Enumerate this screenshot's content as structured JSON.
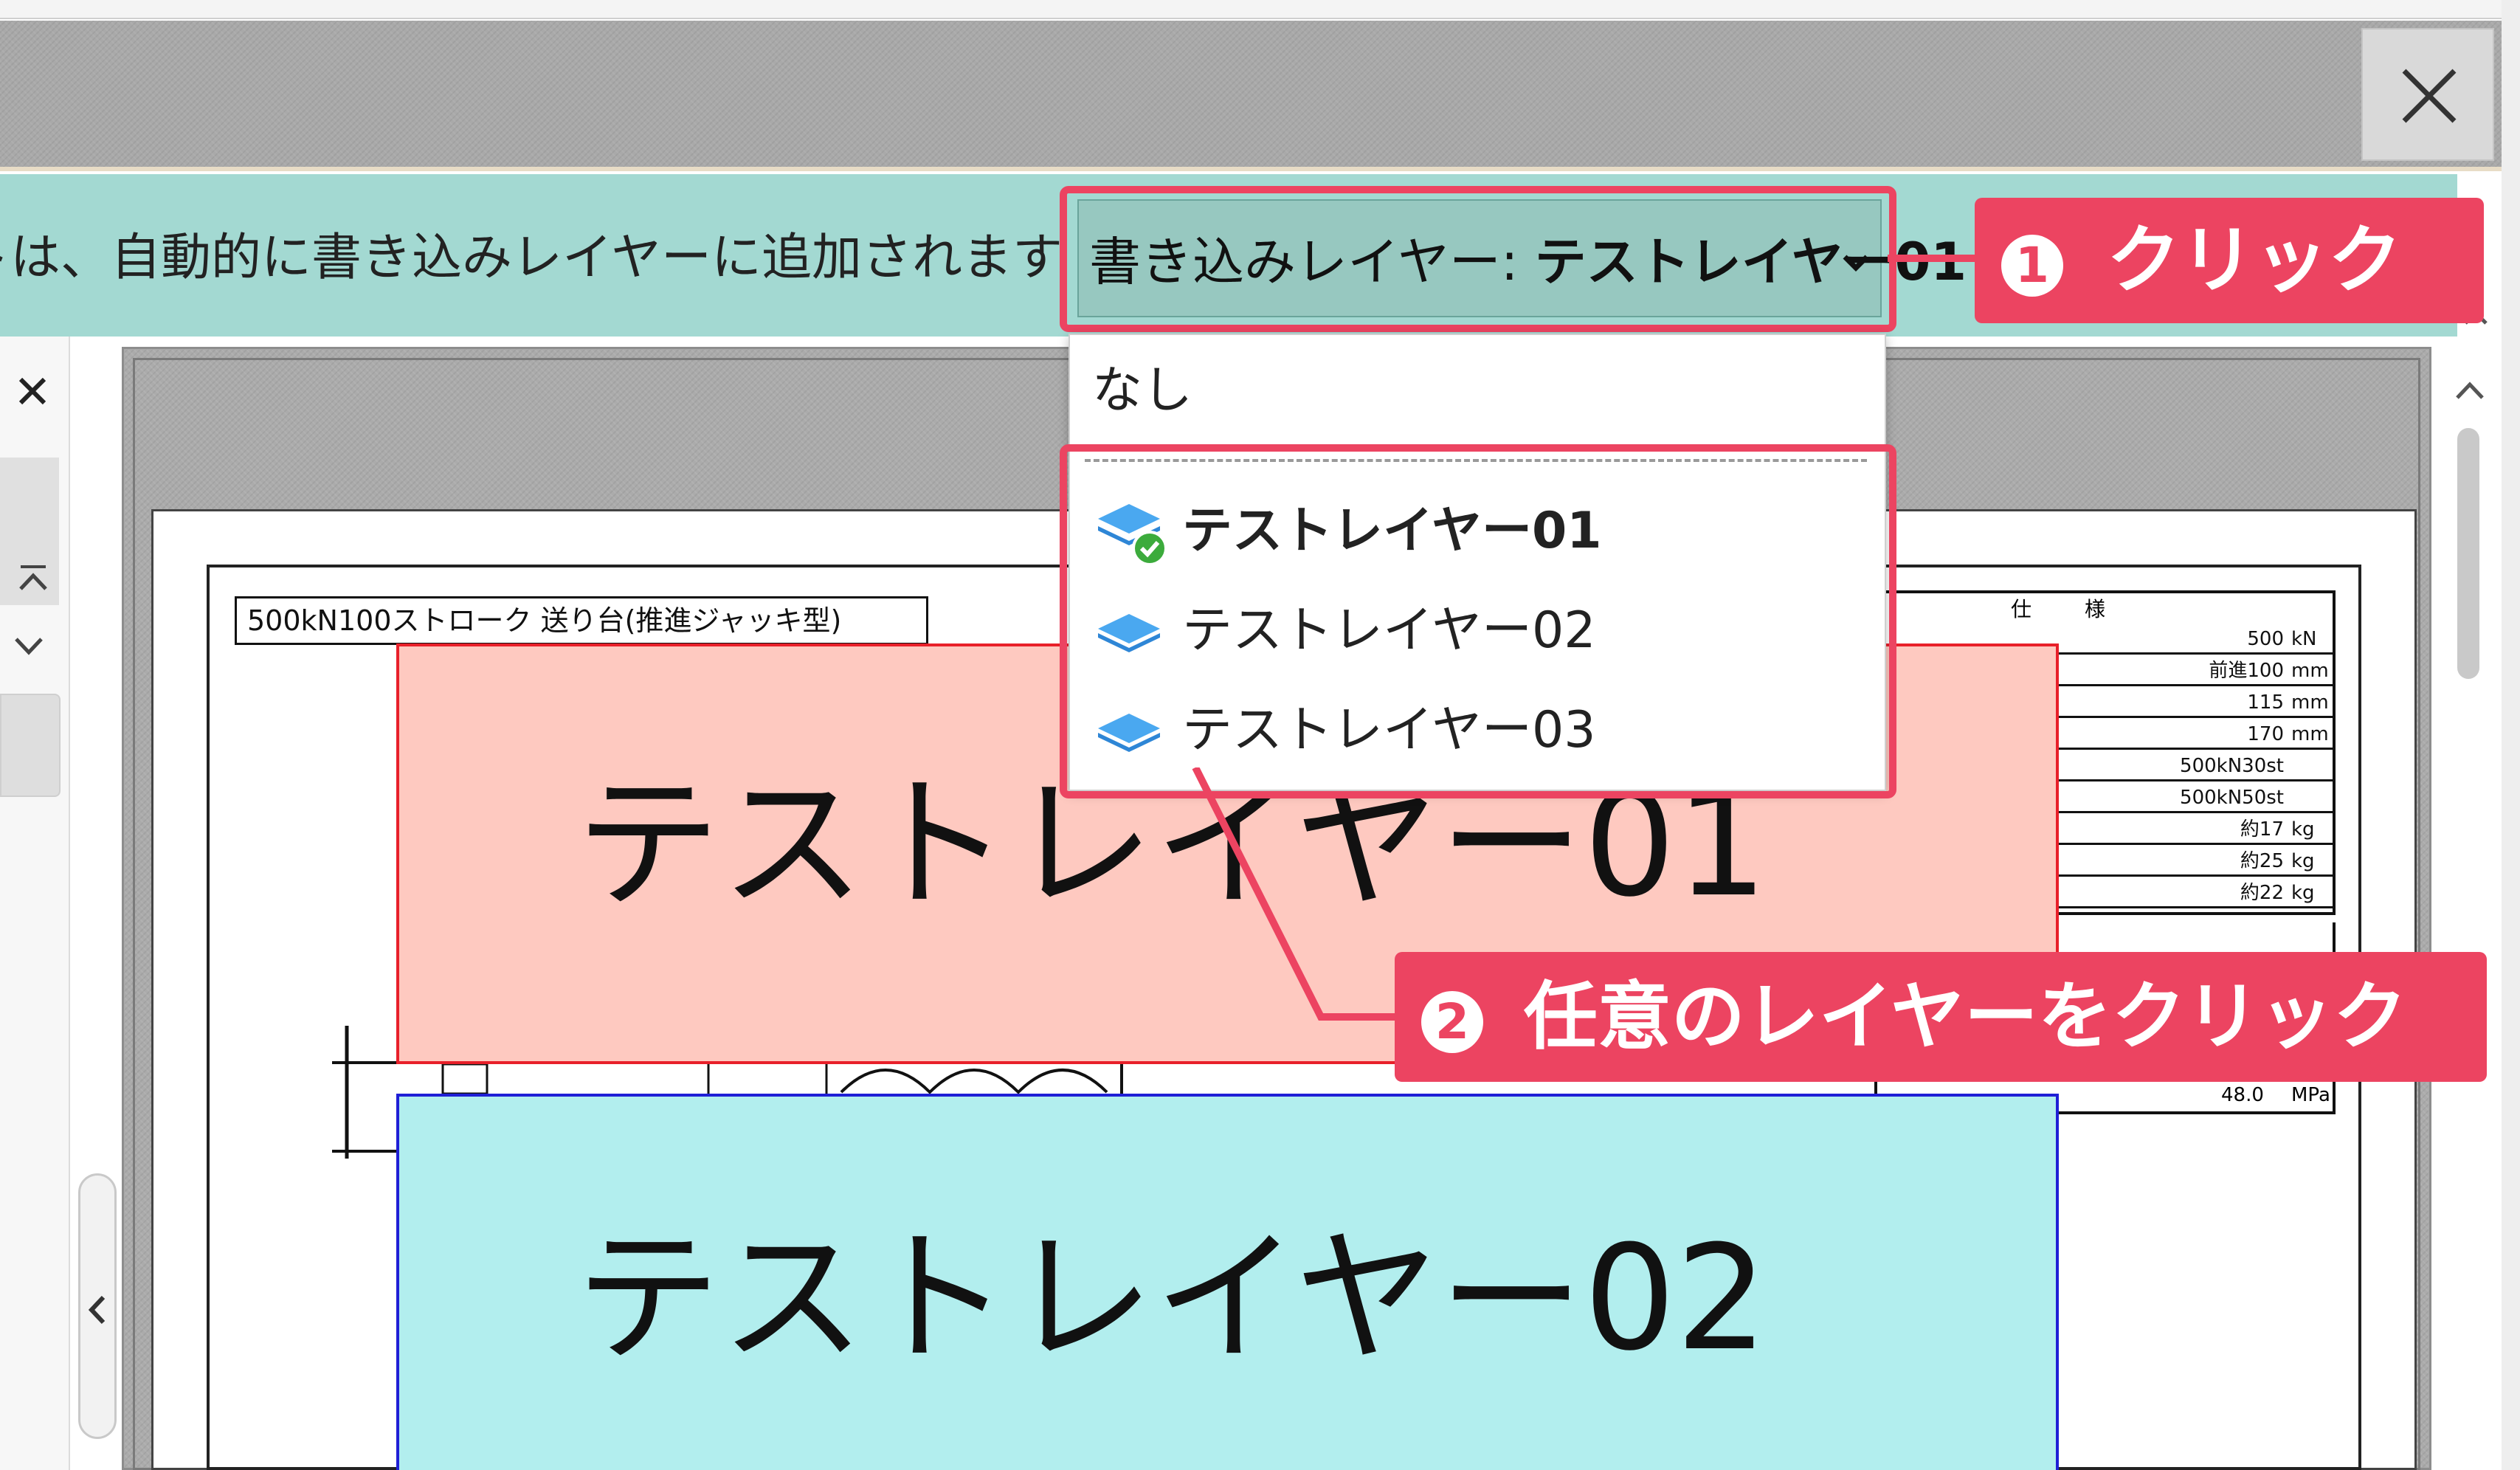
{
  "infobar": {
    "message": "ントは、自動的に書き込みレイヤーに追加されます"
  },
  "layer_select": {
    "prefix": "書き込みレイヤー:",
    "value": "テストレイヤー01"
  },
  "dropdown": {
    "none_label": "なし",
    "items": [
      {
        "label": "テストレイヤー01",
        "selected": true
      },
      {
        "label": "テストレイヤー02",
        "selected": false
      },
      {
        "label": "テストレイヤー03",
        "selected": false
      }
    ]
  },
  "callouts": {
    "step1_number": "1",
    "step1_text": "クリック",
    "step2_number": "2",
    "step2_text": "任意のレイヤーをクリック"
  },
  "drawing": {
    "title": "500kN100ストローク 送り台(推進ジャッキ型)",
    "spec_header_1": "仕",
    "spec_header_2": "様",
    "spec_rows": [
      {
        "value": "500",
        "unit": "kN"
      },
      {
        "value": "前進100",
        "unit": "mm"
      },
      {
        "value": "115",
        "unit": "mm"
      },
      {
        "value": "170",
        "unit": "mm"
      },
      {
        "value": "500kN30st",
        "unit": ""
      },
      {
        "value": "500kN50st",
        "unit": ""
      },
      {
        "value": "約17",
        "unit": "kg"
      },
      {
        "value": "約25",
        "unit": "kg"
      },
      {
        "value": "約22",
        "unit": "kg"
      }
    ],
    "spec_last": {
      "value": "48.0",
      "unit": "MPa"
    }
  },
  "layers": {
    "layer01_text": "テストレイヤー01",
    "layer02_text": "テストレイヤー02"
  },
  "colors": {
    "accent": "#ec4461",
    "infobar": "#a3d9d2",
    "layer01_fill": "#fec9c0",
    "layer01_border": "#e8202a",
    "layer02_fill": "#b2eeee",
    "layer02_border": "#1f1fd6"
  }
}
